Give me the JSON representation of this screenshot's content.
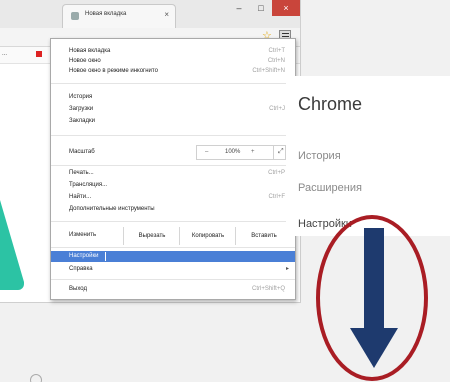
{
  "browser": {
    "tab_title": "Новая вкладка",
    "tab_close": "×",
    "window_controls": [
      "–",
      "□",
      "×"
    ],
    "bookmark_text": "...",
    "star_icon": "star-icon",
    "menu_icon": "hamburger-menu-icon"
  },
  "menu": {
    "group1": [
      {
        "label": "Новая вкладка",
        "shortcut": "Ctrl+T"
      },
      {
        "label": "Новое окно",
        "shortcut": "Ctrl+N"
      },
      {
        "label": "Новое окно в режиме инкогнито",
        "shortcut": "Ctrl+Shift+N"
      }
    ],
    "group2": [
      {
        "label": "История",
        "shortcut": ""
      },
      {
        "label": "Загрузки",
        "shortcut": "Ctrl+J"
      },
      {
        "label": "Закладки",
        "shortcut": ""
      }
    ],
    "zoom": {
      "label": "Масштаб",
      "minus": "–",
      "value": "100%",
      "plus": "+",
      "fullscreen": "⤢"
    },
    "group3": [
      {
        "label": "Печать...",
        "shortcut": "Ctrl+P"
      },
      {
        "label": "Трансляция...",
        "shortcut": ""
      },
      {
        "label": "Найти...",
        "shortcut": "Ctrl+F"
      },
      {
        "label": "Дополнительные инструменты",
        "shortcut": ""
      }
    ],
    "edit": {
      "label": "Изменить",
      "cut": "Вырезать",
      "copy": "Копировать",
      "paste": "Вставить"
    },
    "settings": "Настройки",
    "help": "Справка",
    "exit": {
      "label": "Выход",
      "shortcut": "Ctrl+Shift+Q"
    }
  },
  "panel": {
    "title": "Chrome",
    "items": [
      "История",
      "Расширения",
      "Настройки"
    ]
  },
  "colors": {
    "annotation_ellipse": "#a91d24",
    "annotation_arrow": "#1e3a6e",
    "highlight": "#4a7fd6",
    "accent_teal": "#2cc3a4"
  }
}
